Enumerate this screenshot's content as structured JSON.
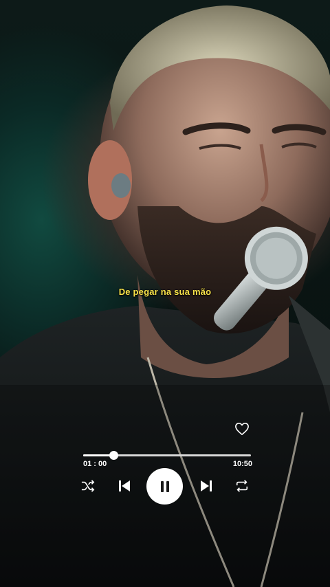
{
  "lyrics": {
    "current_line": "De pegar na sua mão"
  },
  "player": {
    "elapsed": "01 : 00",
    "duration": "10:50",
    "progress": 0.18,
    "liked": false,
    "state": "playing"
  },
  "icons": {
    "like": "heart-icon",
    "shuffle": "shuffle-icon",
    "previous": "skip-previous-icon",
    "pause": "pause-icon",
    "next": "skip-next-icon",
    "repeat": "repeat-icon"
  },
  "colors": {
    "subtitle": "#f7e24a",
    "controls": "#ffffff"
  }
}
